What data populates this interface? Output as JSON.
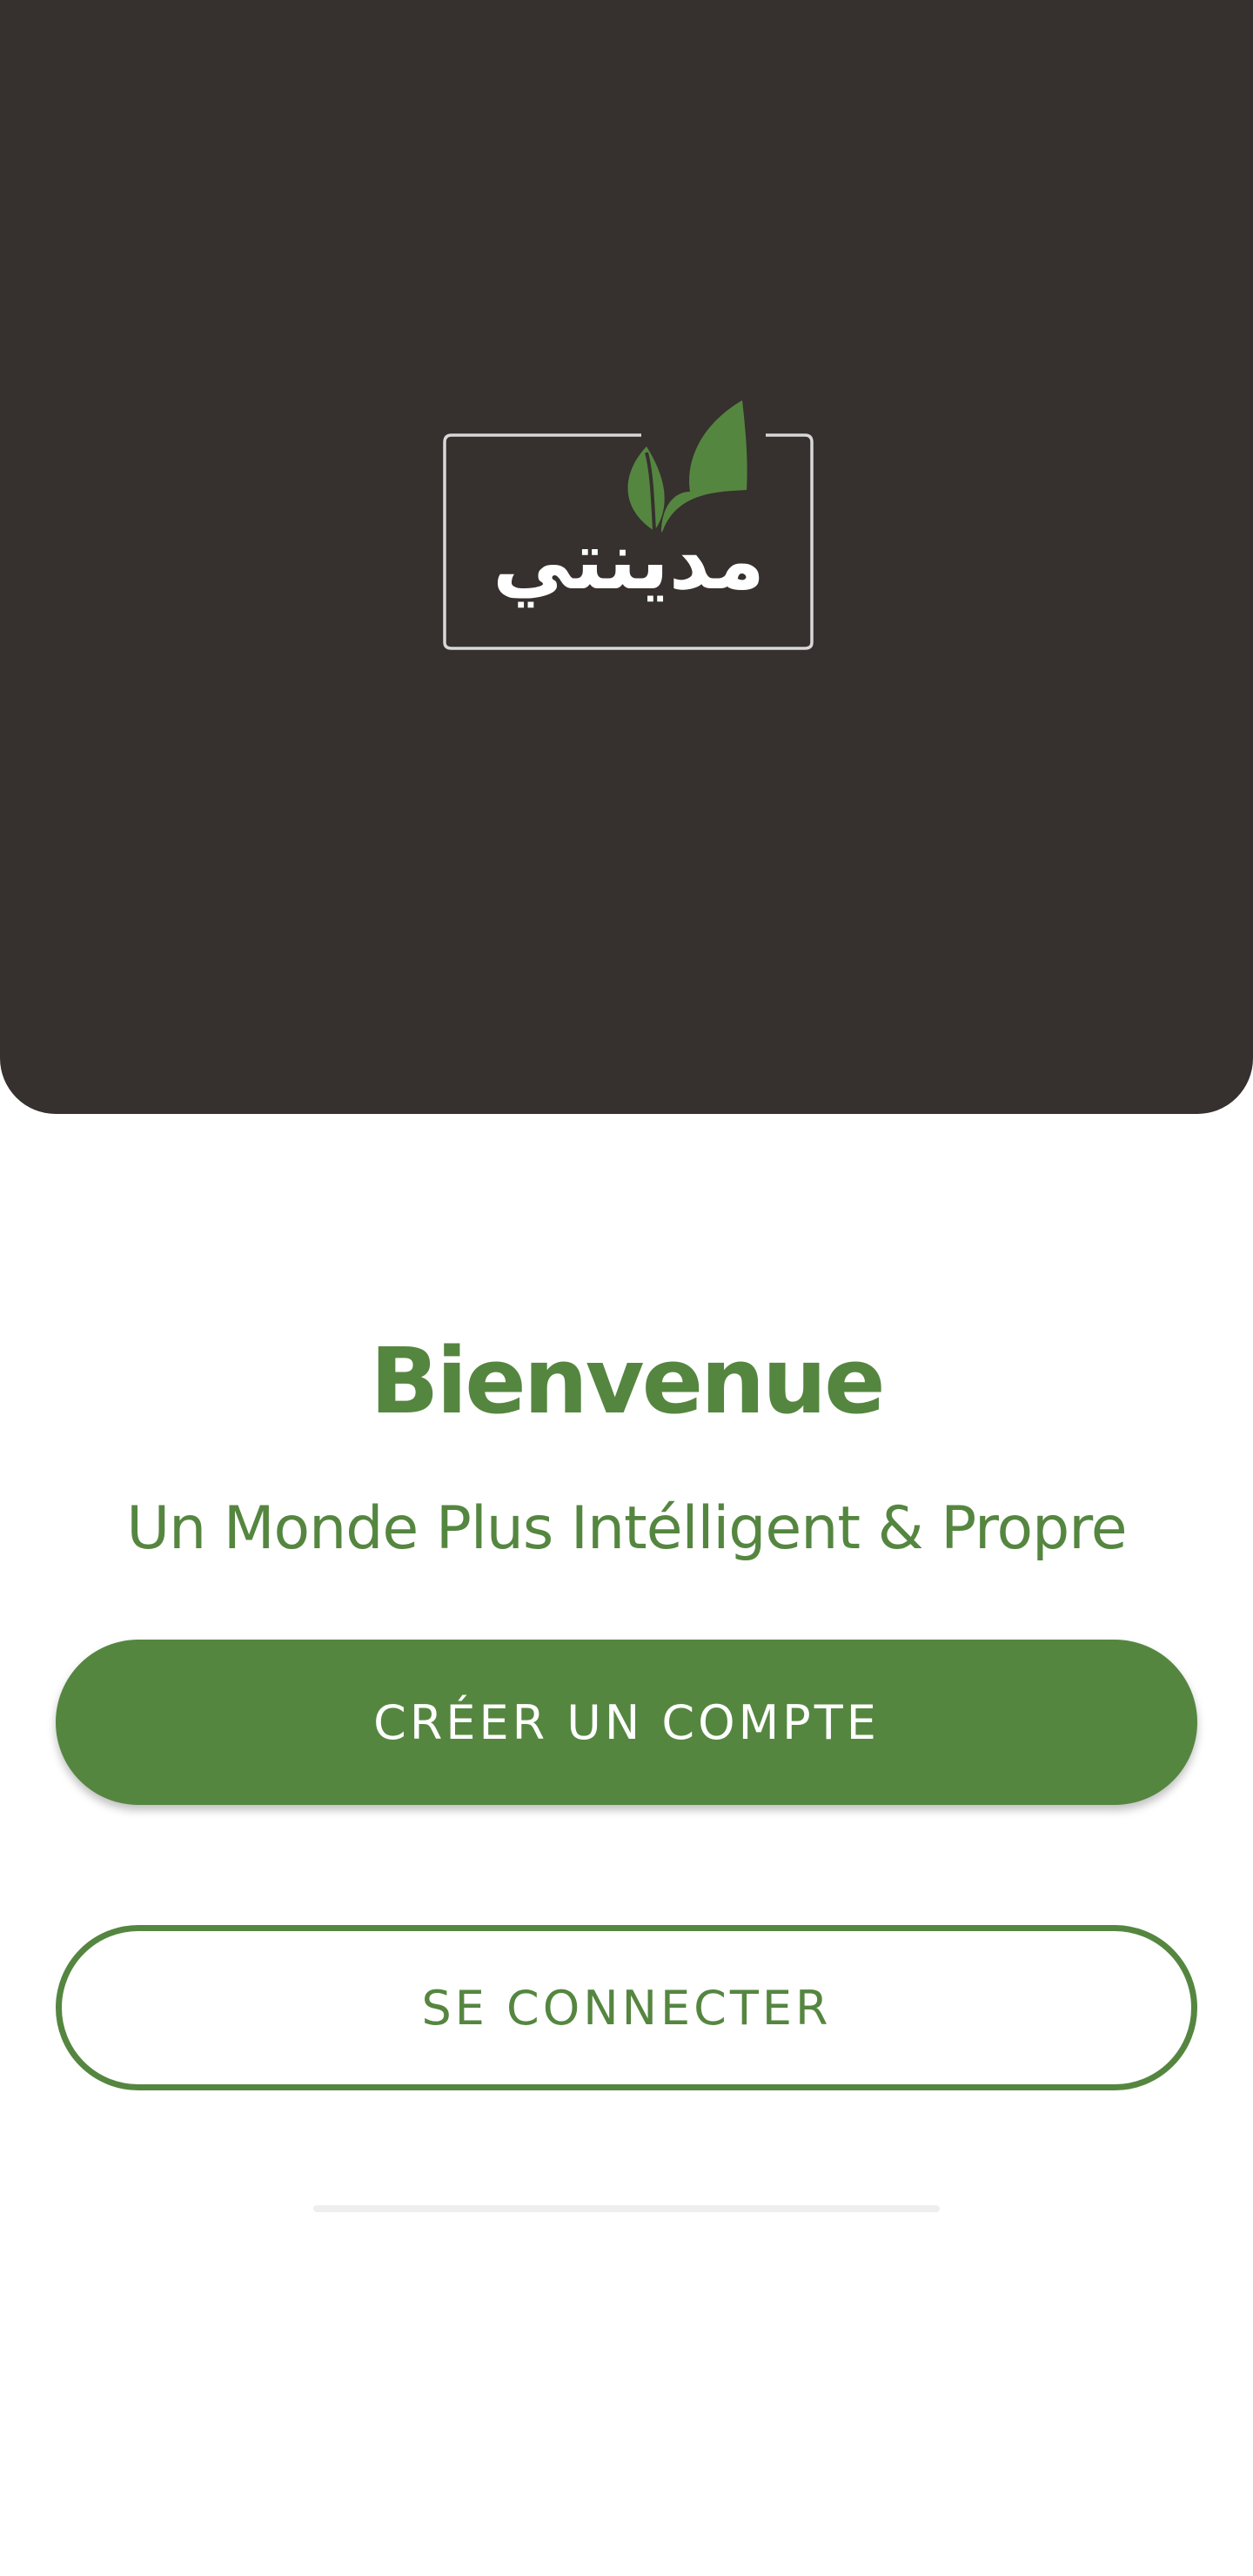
{
  "hero": {
    "background_color": "#36302e",
    "logo": {
      "text": "مدينتي",
      "frame_color": "#d8d8d8",
      "leaf_color": "#558640",
      "icon": "two-leaves-icon"
    }
  },
  "welcome": {
    "title": "Bienvenue",
    "tagline": "Un Monde Plus Intélligent & Propre"
  },
  "actions": {
    "create_account_label": "CRÉER UN COMPTE",
    "login_label": "SE CONNECTER"
  },
  "colors": {
    "accent": "#558640",
    "background": "#ffffff"
  }
}
